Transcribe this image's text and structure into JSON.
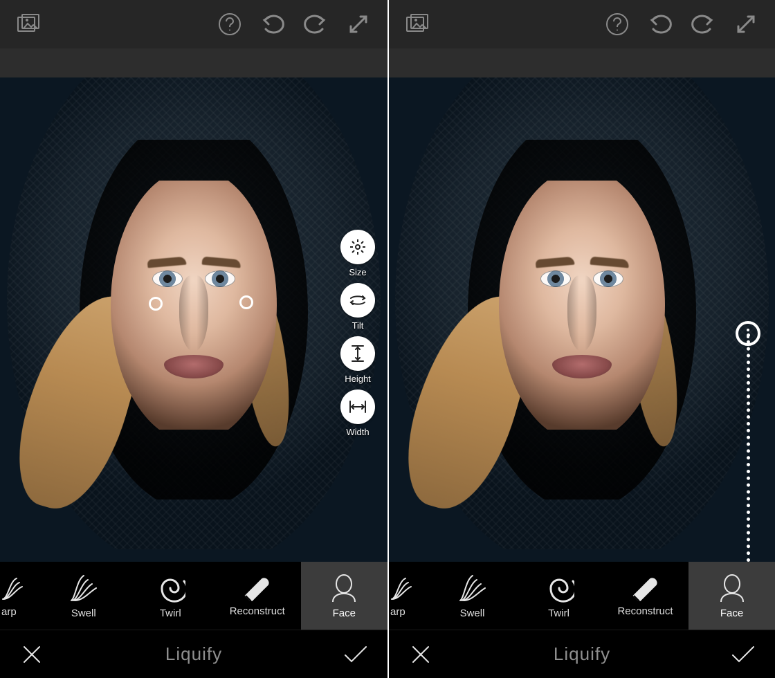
{
  "mode_title": "Liquify",
  "face_tools": [
    {
      "id": "size",
      "label": "Size"
    },
    {
      "id": "tilt",
      "label": "Tilt"
    },
    {
      "id": "height",
      "label": "Height"
    },
    {
      "id": "width",
      "label": "Width"
    }
  ],
  "liquify_tools": [
    {
      "id": "warp",
      "label": "Warp",
      "active": false,
      "truncated_label": "arp"
    },
    {
      "id": "swell",
      "label": "Swell",
      "active": false
    },
    {
      "id": "twirl",
      "label": "Twirl",
      "active": false
    },
    {
      "id": "reconstruct",
      "label": "Reconstruct",
      "active": false
    },
    {
      "id": "face",
      "label": "Face",
      "active": true
    }
  ],
  "icons": {
    "gallery": "gallery-icon",
    "help": "help-icon",
    "undo": "undo-icon",
    "redo": "redo-icon",
    "fullscreen": "expand-icon",
    "cancel": "close-icon",
    "accept": "check-icon"
  }
}
